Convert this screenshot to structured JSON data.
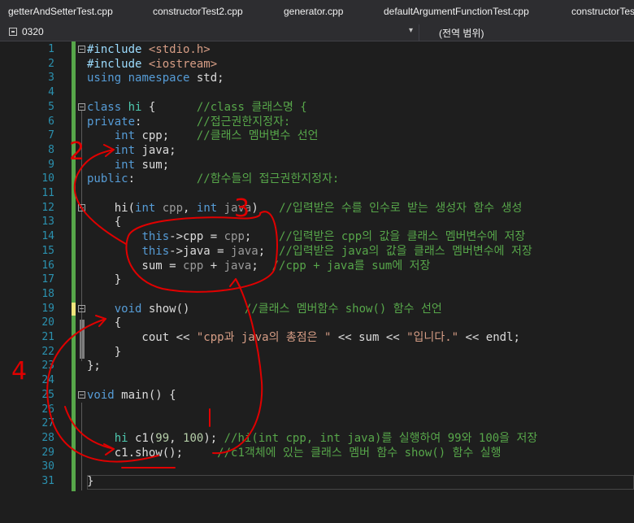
{
  "tabs": [
    "getterAndSetterTest.cpp",
    "constructorTest2.cpp",
    "generator.cpp",
    "defaultArgumentFunctionTest.cpp",
    "constructorTest"
  ],
  "navbar": {
    "left_icon": "scope-icon",
    "left": "0320",
    "right": "(전역 범위)"
  },
  "lines": [
    {
      "n": "1",
      "tokens": [
        [
          "id",
          "#include "
        ],
        [
          "str",
          "<stdio.h>"
        ]
      ]
    },
    {
      "n": "2",
      "tokens": [
        [
          "id",
          "#include "
        ],
        [
          "str",
          "<iostream>"
        ]
      ]
    },
    {
      "n": "3",
      "tokens": [
        [
          "kw",
          "using"
        ],
        [
          "t",
          " "
        ],
        [
          "kw",
          "namespace"
        ],
        [
          "t",
          " std;"
        ]
      ]
    },
    {
      "n": "4",
      "tokens": []
    },
    {
      "n": "5",
      "tokens": [
        [
          "kw",
          "class"
        ],
        [
          "t",
          " "
        ],
        [
          "ty",
          "hi"
        ],
        [
          "t",
          " {      "
        ],
        [
          "cm",
          "//class 클래스명 {"
        ]
      ]
    },
    {
      "n": "6",
      "tokens": [
        [
          "kw",
          "private"
        ],
        [
          "t",
          ":        "
        ],
        [
          "cm",
          "//접근권한지정자:"
        ]
      ]
    },
    {
      "n": "7",
      "tokens": [
        [
          "t",
          "    "
        ],
        [
          "kw",
          "int"
        ],
        [
          "t",
          " cpp;    "
        ],
        [
          "cm",
          "//클래스 멤버변수 선언"
        ]
      ]
    },
    {
      "n": "8",
      "tokens": [
        [
          "t",
          "    "
        ],
        [
          "kw",
          "int"
        ],
        [
          "t",
          " java;"
        ]
      ]
    },
    {
      "n": "9",
      "tokens": [
        [
          "t",
          "    "
        ],
        [
          "kw",
          "int"
        ],
        [
          "t",
          " sum;"
        ]
      ]
    },
    {
      "n": "10",
      "tokens": [
        [
          "kw",
          "public"
        ],
        [
          "t",
          ":         "
        ],
        [
          "cm",
          "//함수들의 접근권한지정자:"
        ]
      ]
    },
    {
      "n": "11",
      "tokens": []
    },
    {
      "n": "12",
      "tokens": [
        [
          "t",
          "    hi("
        ],
        [
          "kw",
          "int"
        ],
        [
          "t",
          " "
        ],
        [
          "par",
          "cpp"
        ],
        [
          "t",
          ", "
        ],
        [
          "kw",
          "int"
        ],
        [
          "t",
          " "
        ],
        [
          "par",
          "java"
        ],
        [
          "t",
          ")   "
        ],
        [
          "cm",
          "//입력받은 수를 인수로 받는 생성자 함수 생성"
        ]
      ]
    },
    {
      "n": "13",
      "tokens": [
        [
          "t",
          "    {"
        ]
      ]
    },
    {
      "n": "14",
      "tokens": [
        [
          "t",
          "        "
        ],
        [
          "kw",
          "this"
        ],
        [
          "t",
          "->cpp = "
        ],
        [
          "par",
          "cpp"
        ],
        [
          "t",
          ";    "
        ],
        [
          "cm",
          "//입력받은 cpp의 값을 클래스 멤버변수에 저장"
        ]
      ]
    },
    {
      "n": "15",
      "tokens": [
        [
          "t",
          "        "
        ],
        [
          "kw",
          "this"
        ],
        [
          "t",
          "->java = "
        ],
        [
          "par",
          "java"
        ],
        [
          "t",
          ";  "
        ],
        [
          "cm",
          "//입력받은 java의 값을 클래스 멤버변수에 저장"
        ]
      ]
    },
    {
      "n": "16",
      "tokens": [
        [
          "t",
          "        sum = "
        ],
        [
          "par",
          "cpp"
        ],
        [
          "t",
          " + "
        ],
        [
          "par",
          "java"
        ],
        [
          "t",
          ";  "
        ],
        [
          "cm",
          "//cpp + java를 sum에 저장"
        ]
      ]
    },
    {
      "n": "17",
      "tokens": [
        [
          "t",
          "    }"
        ]
      ]
    },
    {
      "n": "18",
      "tokens": []
    },
    {
      "n": "19",
      "tokens": [
        [
          "t",
          "    "
        ],
        [
          "kw",
          "void"
        ],
        [
          "t",
          " show()        "
        ],
        [
          "cm",
          "//클래스 멤버함수 show() 함수 선언"
        ]
      ]
    },
    {
      "n": "20",
      "tokens": [
        [
          "t",
          "    {"
        ]
      ]
    },
    {
      "n": "21",
      "tokens": [
        [
          "t",
          "        cout << "
        ],
        [
          "str",
          "\"cpp과 java의 총점은 \""
        ],
        [
          "t",
          " << sum << "
        ],
        [
          "str",
          "\"입니다.\""
        ],
        [
          "t",
          " << endl;"
        ]
      ]
    },
    {
      "n": "22",
      "tokens": [
        [
          "t",
          "    }"
        ]
      ]
    },
    {
      "n": "23",
      "tokens": [
        [
          "t",
          "};"
        ]
      ]
    },
    {
      "n": "24",
      "tokens": []
    },
    {
      "n": "25",
      "tokens": [
        [
          "kw",
          "void"
        ],
        [
          "t",
          " main() {"
        ]
      ]
    },
    {
      "n": "26",
      "tokens": []
    },
    {
      "n": "27",
      "tokens": []
    },
    {
      "n": "28",
      "tokens": [
        [
          "t",
          "    "
        ],
        [
          "ty",
          "hi"
        ],
        [
          "t",
          " c1("
        ],
        [
          "num",
          "99"
        ],
        [
          "t",
          ", "
        ],
        [
          "num",
          "100"
        ],
        [
          "t",
          "); "
        ],
        [
          "cm",
          "//hi(int cpp, int java)를 실행하여 99와 100을 저장"
        ]
      ]
    },
    {
      "n": "29",
      "tokens": [
        [
          "t",
          "    c1.show();     "
        ],
        [
          "cm",
          "//c1객체에 있는 클래스 멤버 함수 show() 함수 실행"
        ]
      ]
    },
    {
      "n": "30",
      "tokens": []
    },
    {
      "n": "31",
      "tokens": [
        [
          "t",
          "}"
        ]
      ]
    }
  ],
  "annotations": {
    "label_2": "2",
    "label_3": "3",
    "label_4": "4"
  },
  "colors": {
    "ink": "#e00000",
    "keyword": "#569cd6",
    "comment": "#57a64a",
    "string": "#d69d85"
  }
}
